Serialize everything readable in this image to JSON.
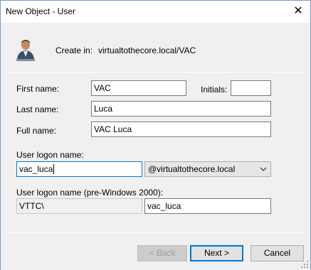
{
  "window": {
    "title": "New Object - User",
    "close_glyph": "✕"
  },
  "header": {
    "icon": "user-icon",
    "create_in_label": "Create in:",
    "create_in_value": "virtualtothecore.local/VAC"
  },
  "form": {
    "first_name_label": "First name:",
    "first_name_value": "VAC",
    "initials_label": "Initials:",
    "initials_value": "",
    "last_name_label": "Last name:",
    "last_name_value": "Luca",
    "full_name_label": "Full name:",
    "full_name_value": "VAC Luca",
    "logon_name_label": "User logon name:",
    "logon_name_value": "vac_luca",
    "domain_suffix_value": "@virtualtothecore.local",
    "pre2000_label": "User logon name (pre-Windows 2000):",
    "pre2000_domain_value": "VTTC\\",
    "pre2000_name_value": "vac_luca"
  },
  "buttons": {
    "back_label": "< Back",
    "next_label": "Next >",
    "cancel_label": "Cancel"
  },
  "colors": {
    "accent": "#0078d7",
    "dialog_bg": "#f0f0f0"
  }
}
